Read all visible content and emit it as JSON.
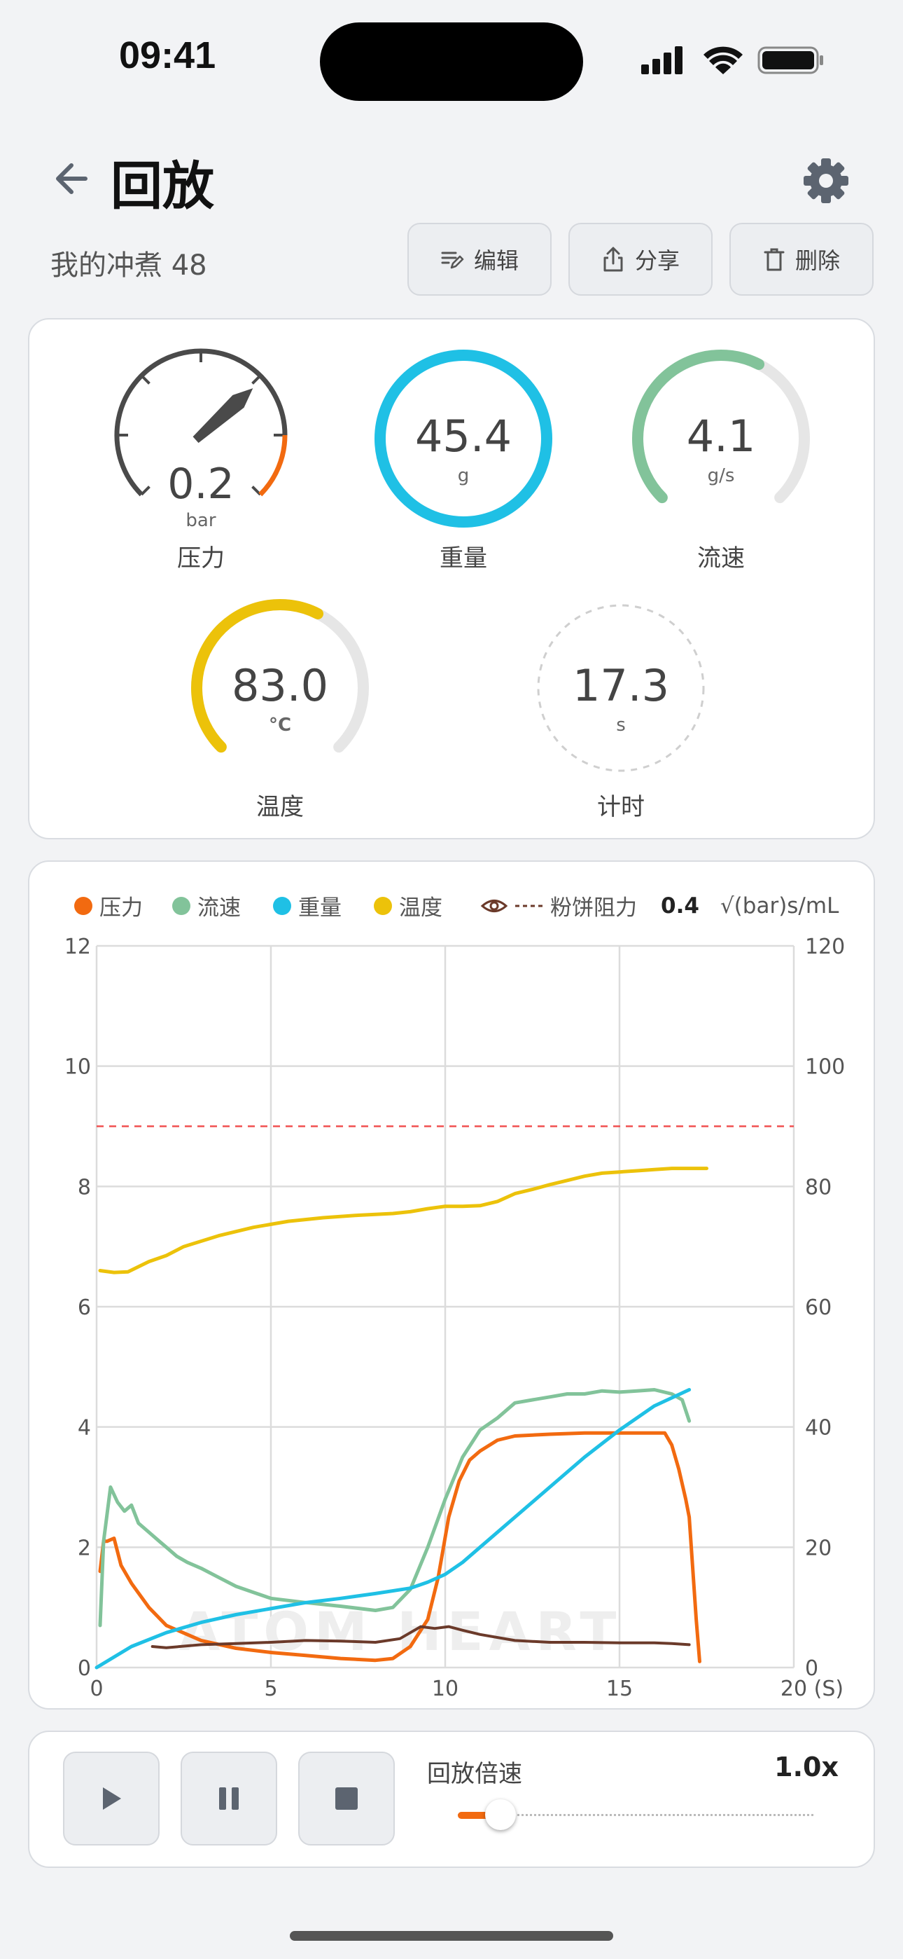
{
  "status_bar": {
    "time": "09:41"
  },
  "header": {
    "title": "回放"
  },
  "brew": {
    "name": "我的冲煮 48"
  },
  "actions": {
    "edit": "编辑",
    "share": "分享",
    "delete": "删除"
  },
  "gauges": {
    "pressure": {
      "value": "0.2",
      "unit": "bar",
      "label": "压力",
      "max": 12,
      "color": "#4a4a4a",
      "accent": "#f26a10"
    },
    "weight": {
      "value": "45.4",
      "unit": "g",
      "label": "重量",
      "color": "#1fc0e5"
    },
    "flow": {
      "value": "4.1",
      "unit": "g/s",
      "label": "流速",
      "color": "#82c39a",
      "fraction": 0.6
    },
    "temperature": {
      "value": "83.0",
      "unit": "°C",
      "label": "温度",
      "color": "#ecc20a",
      "fraction": 0.6
    },
    "timer": {
      "value": "17.3",
      "unit": "s",
      "label": "计时"
    }
  },
  "legend": {
    "pressure": "压力",
    "flow": "流速",
    "weight": "重量",
    "temperature": "温度",
    "puck_resistance": "粉饼阻力",
    "puck_value": "0.4",
    "puck_unit": "√(bar)s/mL"
  },
  "watermark": "ATOM HEART",
  "chart_data": {
    "type": "line",
    "x_axis": {
      "min": 0,
      "max": 20,
      "ticks": [
        0,
        5,
        10,
        15,
        20
      ],
      "last_tick_label": "20 (S)"
    },
    "y_left": {
      "min": 0,
      "max": 12,
      "ticks": [
        0,
        2,
        4,
        6,
        8,
        10,
        12
      ]
    },
    "y_right": {
      "min": 0,
      "max": 120,
      "ticks": [
        0,
        20,
        40,
        60,
        80,
        100,
        120
      ]
    },
    "grid": true,
    "reference_line": {
      "y": 9,
      "axis": "left",
      "color": "#f05050",
      "style": "dashed"
    },
    "series": [
      {
        "name": "温度",
        "axis": "right",
        "color": "#ecc20a",
        "x": [
          0.1,
          0.5,
          0.9,
          1.5,
          2.0,
          2.5,
          3.5,
          4.5,
          5.5,
          6.5,
          7.5,
          8.5,
          9.0,
          9.5,
          10.0,
          10.5,
          11.0,
          11.5,
          12.0,
          12.5,
          13.0,
          13.5,
          14.0,
          14.5,
          15.0,
          15.5,
          16.0,
          16.5,
          17.0,
          17.5
        ],
        "y": [
          66,
          65.7,
          65.8,
          67.5,
          68.5,
          70,
          71.8,
          73.2,
          74.2,
          74.8,
          75.2,
          75.5,
          75.8,
          76.3,
          76.7,
          76.7,
          76.8,
          77.5,
          78.8,
          79.5,
          80.3,
          81,
          81.7,
          82.2,
          82.4,
          82.6,
          82.8,
          83,
          83,
          83
        ]
      },
      {
        "name": "压力",
        "axis": "left",
        "color": "#f26a10",
        "x": [
          0.1,
          0.2,
          0.3,
          0.5,
          0.7,
          1.0,
          1.5,
          2.0,
          3.0,
          4.0,
          5.0,
          6.0,
          7.0,
          8.0,
          8.5,
          9.0,
          9.5,
          9.8,
          10.1,
          10.4,
          10.7,
          11.0,
          11.5,
          12.0,
          13.0,
          14.0,
          15.0,
          15.5,
          16.0,
          16.3,
          16.5,
          16.7,
          16.9,
          17.0,
          17.2,
          17.3
        ],
        "y": [
          1.6,
          2.1,
          2.1,
          2.15,
          1.7,
          1.4,
          1.0,
          0.7,
          0.45,
          0.32,
          0.25,
          0.2,
          0.15,
          0.12,
          0.15,
          0.35,
          0.8,
          1.5,
          2.5,
          3.1,
          3.45,
          3.6,
          3.78,
          3.85,
          3.88,
          3.9,
          3.9,
          3.9,
          3.9,
          3.9,
          3.7,
          3.3,
          2.8,
          2.5,
          0.8,
          0.1
        ]
      },
      {
        "name": "流速",
        "axis": "left",
        "color": "#82c39a",
        "x": [
          0.1,
          0.2,
          0.4,
          0.6,
          0.8,
          1.0,
          1.2,
          1.5,
          1.8,
          2.0,
          2.3,
          2.6,
          3.0,
          3.5,
          4.0,
          4.5,
          5.0,
          6.0,
          7.0,
          8.0,
          8.5,
          9.0,
          9.5,
          10.0,
          10.5,
          11.0,
          11.5,
          12.0,
          12.5,
          13.0,
          13.5,
          14.0,
          14.5,
          15.0,
          15.5,
          16.0,
          16.5,
          16.8,
          17.0
        ],
        "y": [
          0.7,
          2.1,
          3.0,
          2.75,
          2.6,
          2.7,
          2.4,
          2.25,
          2.1,
          2.0,
          1.85,
          1.75,
          1.65,
          1.5,
          1.35,
          1.25,
          1.15,
          1.08,
          1.02,
          0.95,
          1.0,
          1.3,
          2.0,
          2.8,
          3.5,
          3.95,
          4.15,
          4.4,
          4.45,
          4.5,
          4.55,
          4.55,
          4.6,
          4.58,
          4.6,
          4.62,
          4.55,
          4.45,
          4.1
        ]
      },
      {
        "name": "重量",
        "axis": "right",
        "color": "#1fc0e5",
        "x": [
          0,
          1,
          2,
          3,
          4,
          5,
          6,
          7,
          8,
          9,
          9.5,
          10,
          10.5,
          11,
          12,
          13,
          14,
          15,
          16,
          17
        ],
        "y": [
          0,
          3.5,
          5.8,
          7.5,
          8.8,
          9.8,
          10.8,
          11.5,
          12.3,
          13.2,
          14.2,
          15.5,
          17.5,
          20,
          25,
          30,
          35,
          39.5,
          43.5,
          46.2
        ]
      },
      {
        "name": "粉饼阻力",
        "axis": "left",
        "color": "#6b3a2a",
        "x": [
          1.6,
          2.0,
          3.0,
          4.0,
          5.0,
          6.0,
          7.0,
          8.0,
          8.7,
          9.0,
          9.3,
          9.7,
          10.1,
          10.5,
          11.0,
          12.0,
          13.0,
          14.0,
          15.0,
          16.0,
          16.5,
          17.0
        ],
        "y": [
          0.35,
          0.33,
          0.38,
          0.4,
          0.42,
          0.45,
          0.44,
          0.42,
          0.48,
          0.58,
          0.68,
          0.65,
          0.68,
          0.62,
          0.55,
          0.45,
          0.42,
          0.42,
          0.41,
          0.41,
          0.4,
          0.38
        ]
      }
    ]
  },
  "playback": {
    "speed_label": "回放倍速",
    "speed_value": "1.0x",
    "speed_fraction": 0.1
  }
}
